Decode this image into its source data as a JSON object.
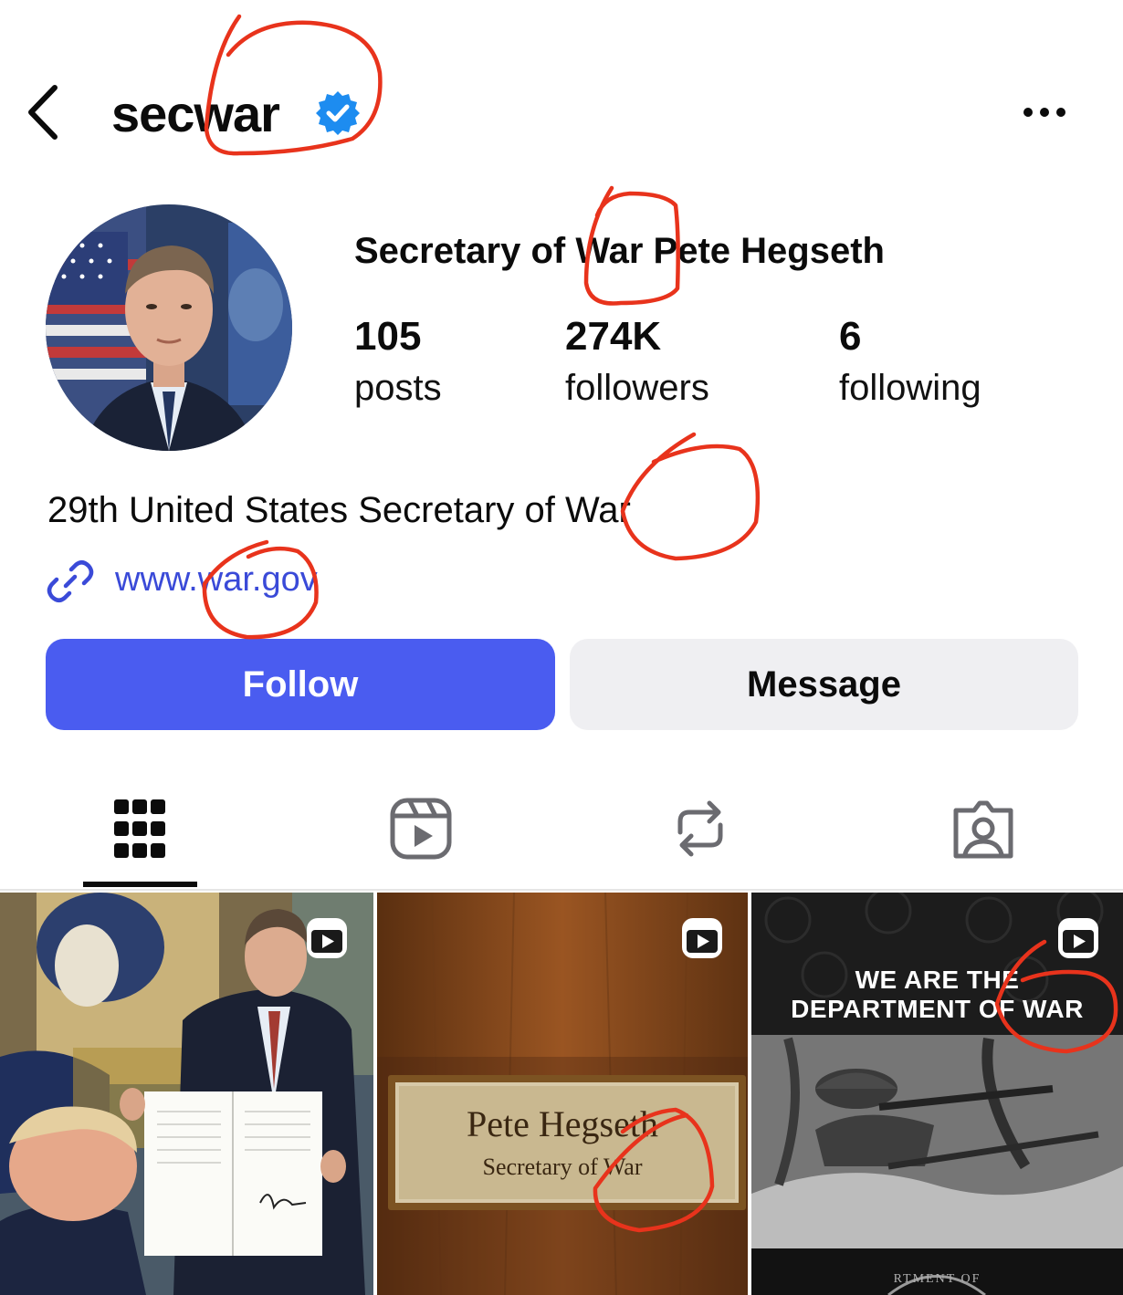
{
  "header": {
    "username": "secwar",
    "back_icon": "chevron-left-icon",
    "more_icon": "more-horizontal-icon",
    "verified_icon": "verified-badge-icon"
  },
  "profile": {
    "display_name": "Secretary of War Pete Hegseth",
    "stats": {
      "posts_count": "105",
      "posts_label": "posts",
      "followers_count": "274K",
      "followers_label": "followers",
      "following_count": "6",
      "following_label": "following"
    },
    "bio": "29th United States Secretary of War",
    "link": "www.war.gov",
    "link_icon": "link-icon"
  },
  "actions": {
    "follow_label": "Follow",
    "message_label": "Message"
  },
  "tabs": [
    {
      "name": "grid",
      "icon": "grid-icon",
      "active": true
    },
    {
      "name": "reels",
      "icon": "reels-icon",
      "active": false
    },
    {
      "name": "reposts",
      "icon": "repost-icon",
      "active": false
    },
    {
      "name": "tagged",
      "icon": "tagged-person-icon",
      "active": false
    }
  ],
  "posts": [
    {
      "type": "reel",
      "icon": "reel-icon"
    },
    {
      "type": "reel",
      "icon": "reel-icon",
      "nameplate_name": "Pete Hegseth",
      "nameplate_title": "Secretary of War"
    },
    {
      "type": "reel",
      "icon": "reel-icon",
      "caption_line1": "WE ARE THE",
      "caption_line2": "DEPARTMENT OF WAR",
      "seal_text": "RTMENT OF"
    }
  ],
  "colors": {
    "accent": "#4a5cf0",
    "link": "#3a4ad8",
    "verified": "#1d8cf0",
    "annotation": "#e8331c"
  }
}
